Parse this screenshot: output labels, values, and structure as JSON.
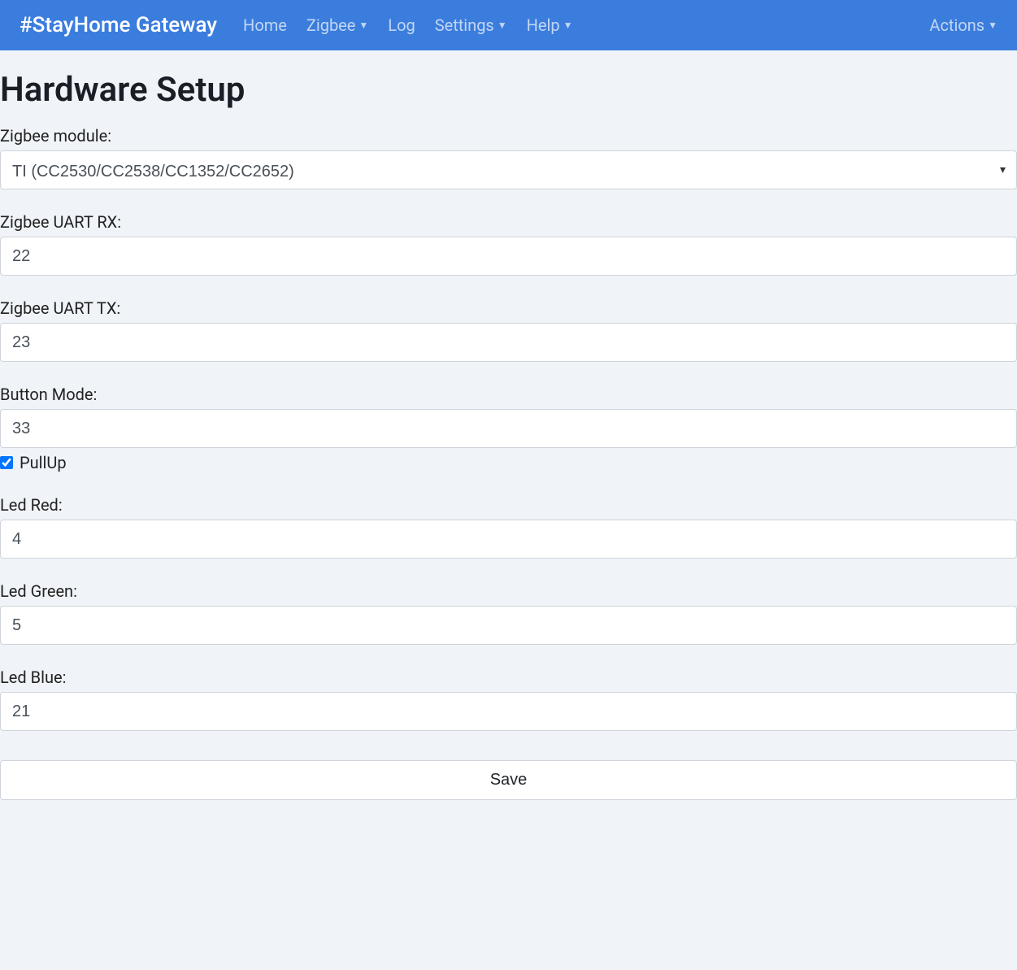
{
  "navbar": {
    "brand": "#StayHome Gateway",
    "items": [
      {
        "label": "Home",
        "dropdown": false
      },
      {
        "label": "Zigbee",
        "dropdown": true
      },
      {
        "label": "Log",
        "dropdown": false
      },
      {
        "label": "Settings",
        "dropdown": true
      },
      {
        "label": "Help",
        "dropdown": true
      }
    ],
    "actions": {
      "label": "Actions",
      "dropdown": true
    }
  },
  "page": {
    "title": "Hardware Setup"
  },
  "form": {
    "zigbee_module": {
      "label": "Zigbee module:",
      "value": "TI (CC2530/CC2538/CC1352/CC2652)"
    },
    "uart_rx": {
      "label": "Zigbee UART RX:",
      "value": "22"
    },
    "uart_tx": {
      "label": "Zigbee UART TX:",
      "value": "23"
    },
    "button_mode": {
      "label": "Button Mode:",
      "value": "33",
      "pullup_label": "PullUp",
      "pullup_checked": true
    },
    "led_red": {
      "label": "Led Red:",
      "value": "4"
    },
    "led_green": {
      "label": "Led Green:",
      "value": "5"
    },
    "led_blue": {
      "label": "Led Blue:",
      "value": "21"
    },
    "save_label": "Save"
  }
}
